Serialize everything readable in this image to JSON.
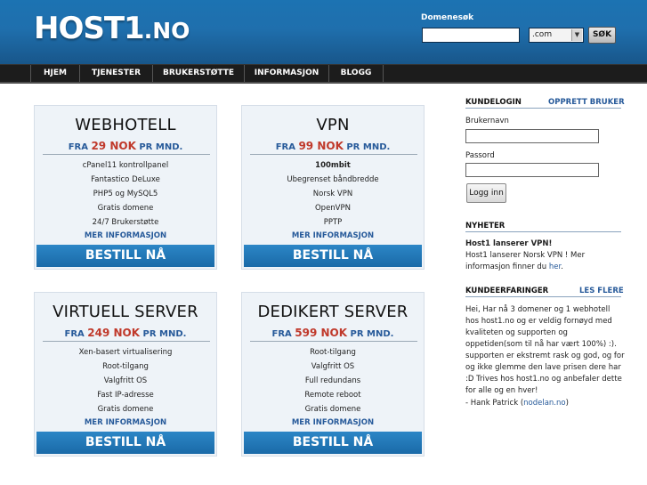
{
  "header": {
    "logo_main": "HOST1",
    "logo_suffix": ".NO",
    "domain_label": "Domenesøk",
    "domain_value": "",
    "tld_selected": ".com",
    "search_label": "SØK"
  },
  "nav": [
    "HJEM",
    "TJENESTER",
    "BRUKERSTØTTE",
    "INFORMASJON",
    "BLOGG"
  ],
  "products": [
    {
      "title": "WEBHOTELL",
      "price_prefix": "FRA ",
      "price_amount": "29 NOK",
      "price_suffix": " PR MND.",
      "features": [
        "cPanel11 kontrollpanel",
        "Fantastico DeLuxe",
        "PHP5 og MySQL5",
        "Gratis domene",
        "24/7 Brukerstøtte"
      ],
      "more": "MER INFORMASJON",
      "order": "BESTILL NÅ"
    },
    {
      "title": "VPN",
      "price_prefix": "FRA ",
      "price_amount": "99 NOK",
      "price_suffix": " PR MND.",
      "features": [
        "100mbit",
        "Ubegrenset båndbredde",
        "Norsk VPN",
        "OpenVPN",
        "PPTP"
      ],
      "more": "MER INFORMASJON",
      "order": "BESTILL NÅ"
    },
    {
      "title": "VIRTUELL SERVER",
      "price_prefix": "FRA ",
      "price_amount": "249 NOK",
      "price_suffix": " PR MND.",
      "features": [
        "Xen-basert virtualisering",
        "Root-tilgang",
        "Valgfritt OS",
        "Fast IP-adresse",
        "Gratis domene"
      ],
      "more": "MER INFORMASJON",
      "order": "BESTILL NÅ"
    },
    {
      "title": "DEDIKERT SERVER",
      "price_prefix": "FRA ",
      "price_amount": "599 NOK",
      "price_suffix": " PR MND.",
      "features": [
        "Root-tilgang",
        "Valgfritt OS",
        "Full redundans",
        "Remote reboot",
        "Gratis domene"
      ],
      "more": "MER INFORMASJON",
      "order": "BESTILL NÅ"
    }
  ],
  "sidebar": {
    "login_heading": "KUNDELOGIN",
    "register_link": "OPPRETT BRUKER",
    "username_label": "Brukernavn",
    "password_label": "Passord",
    "login_button": "Logg inn",
    "news_heading": "NYHETER",
    "news_title": "Host1 lanserer VPN!",
    "news_body": "Host1 lanserer Norsk VPN ! Mer informasjon finner du ",
    "news_link": "her",
    "news_end": ".",
    "reviews_heading": "KUNDEERFARINGER",
    "reviews_link": "LES FLERE",
    "review_text": "Hei, Har nå 3 domener og 1 webhotell hos host1.no og er veldig fornøyd med kvaliteten og supporten og oppetiden(som til nå har vært 100%) :). supporten er ekstremt rask og god, og for og ikke glemme den lave prisen dere har :D Trives hos host1.no og anbefaler dette for alle og en hver!",
    "review_author_prefix": "- Hank Patrick (",
    "review_author_link": "nodelan.no",
    "review_author_suffix": ")"
  },
  "colors": {
    "header_blue": "#1f6fad",
    "nav_bg": "#1c1c1c",
    "link_blue": "#275a9a",
    "price_red": "#c0392b",
    "box_bg": "#eef3f8",
    "button_blue": "#2c86c6"
  }
}
